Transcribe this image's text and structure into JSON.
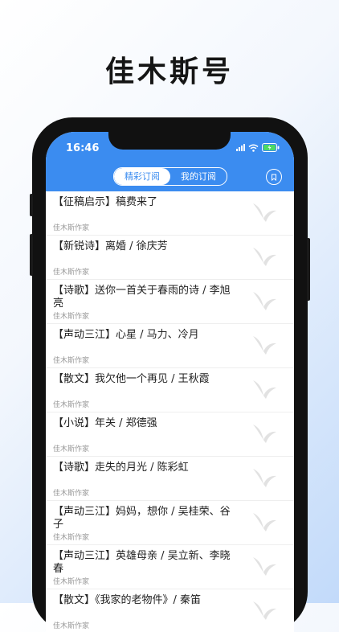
{
  "promo": {
    "title": "佳木斯号"
  },
  "status_bar": {
    "time": "16:46"
  },
  "tabs": [
    {
      "label": "精彩订阅",
      "active": true
    },
    {
      "label": "我的订阅",
      "active": false
    }
  ],
  "feed": [
    {
      "title": "【征稿启示】稿费来了",
      "author": "佳木斯作家"
    },
    {
      "title": "【新锐诗】离婚 / 徐庆芳",
      "author": "佳木斯作家"
    },
    {
      "title": "【诗歌】送你一首关于春雨的诗 / 李旭亮",
      "author": "佳木斯作家"
    },
    {
      "title": "【声动三江】心星 / 马力、冷月",
      "author": "佳木斯作家"
    },
    {
      "title": "【散文】我欠他一个再见 / 王秋霞",
      "author": "佳木斯作家"
    },
    {
      "title": "【小说】年关 / 郑德强",
      "author": "佳木斯作家"
    },
    {
      "title": "【诗歌】走失的月光 / 陈彩虹",
      "author": "佳木斯作家"
    },
    {
      "title": "【声动三江】妈妈，想你 / 吴桂荣、谷子",
      "author": "佳木斯作家"
    },
    {
      "title": "【声动三江】英雄母亲 / 吴立新、李晓春",
      "author": "佳木斯作家"
    },
    {
      "title": "【散文】《我家的老物件》/ 秦笛",
      "author": "佳木斯作家"
    }
  ],
  "colors": {
    "header_blue": "#3b8cf0",
    "author_gray": "#999999"
  },
  "icons": {
    "thumbnail": "bird-logo-icon",
    "bookmark": "bookmark-icon"
  }
}
